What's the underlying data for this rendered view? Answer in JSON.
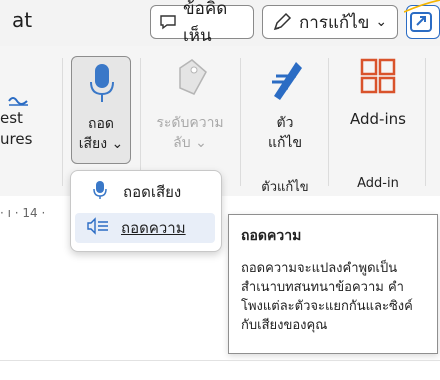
{
  "titlebar": {
    "cut_title": "at",
    "comment_label": "ข้อคิดเห็น",
    "editing_label": "การแก้ไข",
    "editing_chevron": "⌄"
  },
  "ribbon": {
    "left_partial": [
      "est",
      "ures"
    ],
    "dictate": {
      "line1": "ถอด",
      "line2": "เสียง",
      "chevron": "⌄"
    },
    "level": {
      "line1": "ระดับความ",
      "line2": "ลับ",
      "chevron": "⌄"
    },
    "editor": {
      "line1": "ตัว",
      "line2": "แก้ไข"
    },
    "addins": {
      "label": "Add-ins"
    },
    "group_labels": {
      "editor": "ตัวแก้ไข",
      "addin": "Add-in"
    }
  },
  "dropdown": {
    "items": [
      {
        "label": "ถอดเสียง",
        "icon": "microphone-icon"
      },
      {
        "label": "ถอดความ",
        "icon": "transcribe-icon"
      }
    ]
  },
  "tooltip": {
    "title": "ถอดความ",
    "body": "ถอดความจะแปลงคำพูดเป็นสำเนาบทสนทนาข้อความ คำโพงแต่ละตัวจะแยกกันและซิงค์กับเสียงของคุณ"
  },
  "ruler": {
    "text": "· ı · 14 ·"
  },
  "colors": {
    "accent_blue": "#2b6cc4",
    "mic_blue": "#3a78c8",
    "addins_orange": "#d9532b"
  }
}
